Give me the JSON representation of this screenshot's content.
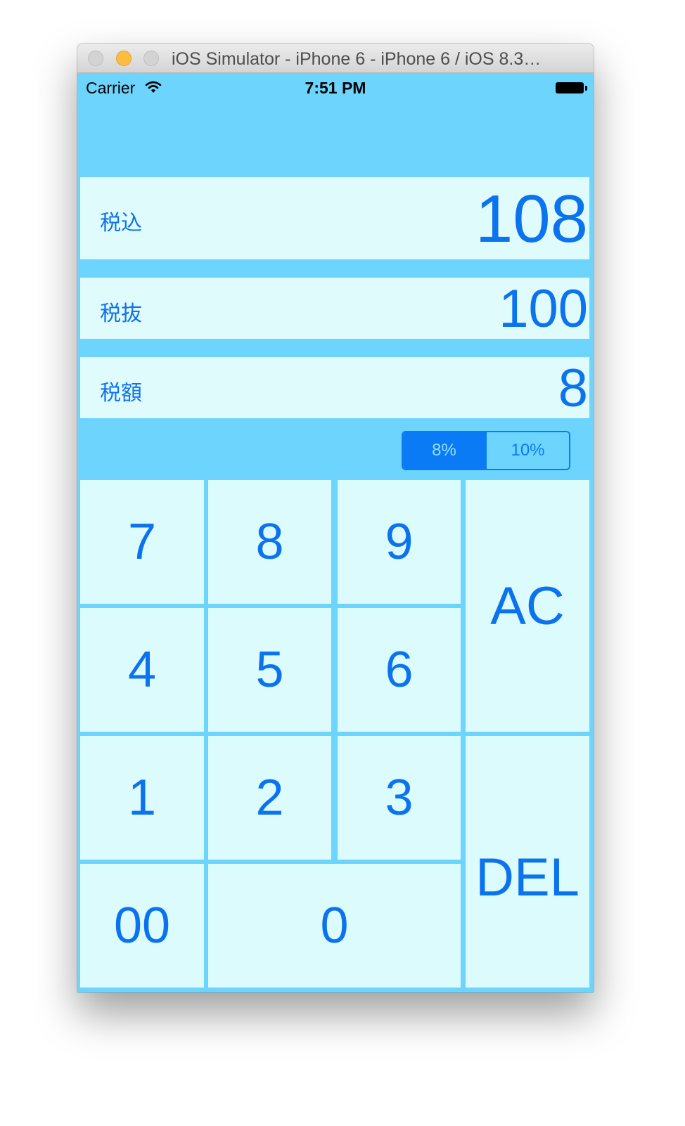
{
  "window": {
    "title": "iOS Simulator - iPhone 6 - iPhone 6 / iOS 8.3…"
  },
  "statusbar": {
    "carrier": "Carrier",
    "time": "7:51 PM"
  },
  "display": {
    "incl": {
      "label": "税込",
      "value": "108"
    },
    "excl": {
      "label": "税抜",
      "value": "100"
    },
    "tax": {
      "label": "税額",
      "value": "8"
    }
  },
  "rate": {
    "options": [
      "8%",
      "10%"
    ],
    "selected": "8%"
  },
  "keypad": {
    "k7": "7",
    "k8": "8",
    "k9": "9",
    "k4": "4",
    "k5": "5",
    "k6": "6",
    "k1": "1",
    "k2": "2",
    "k3": "3",
    "k00": "00",
    "k0": "0",
    "ac": "AC",
    "del": "DEL"
  },
  "colors": {
    "background": "#6dd5fd",
    "panel": "#e0fbfc",
    "accent": "#0c73ee"
  }
}
